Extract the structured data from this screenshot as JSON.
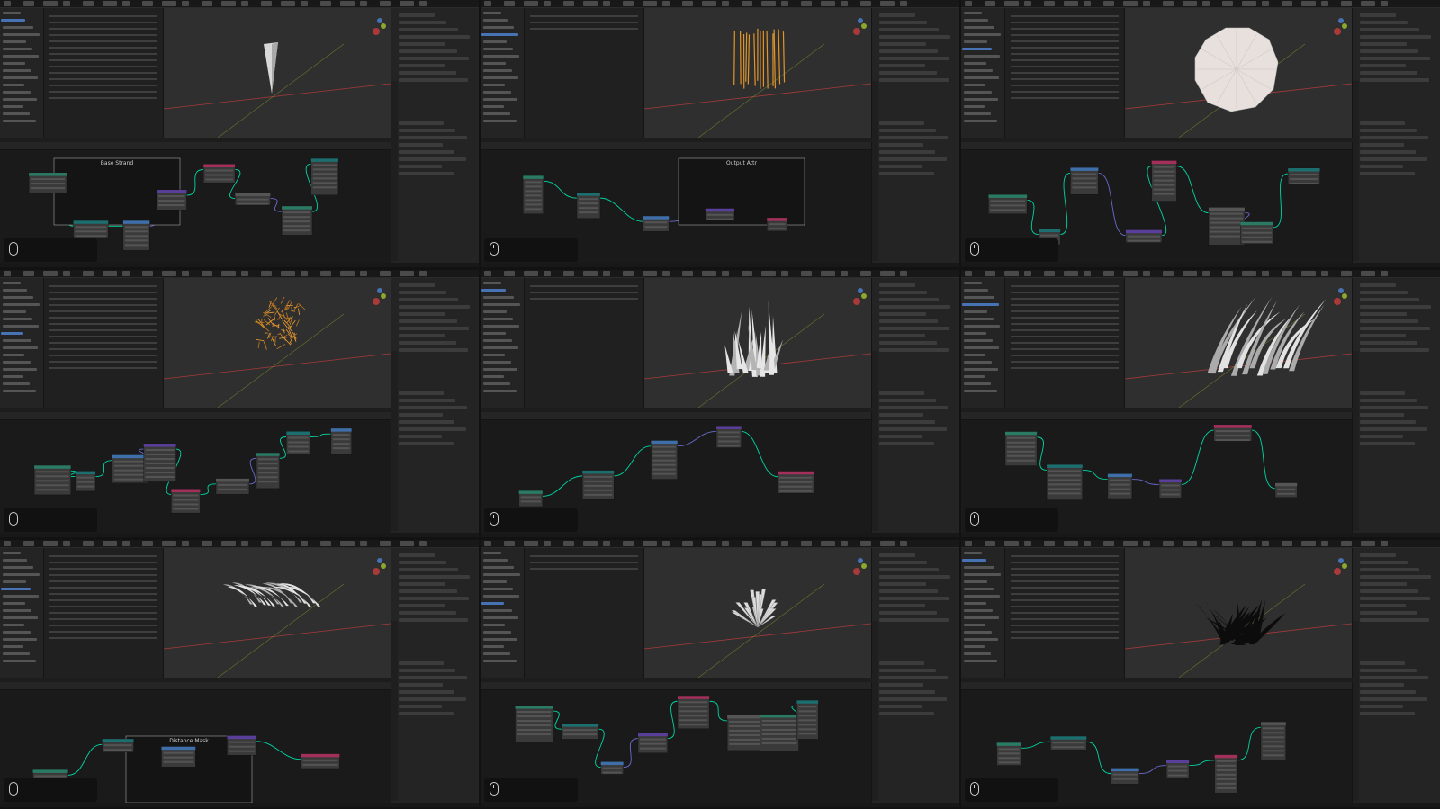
{
  "colors": {
    "accent": "#4772b3",
    "geometry_link": "#00d6a3",
    "node_header_green": "#2a7a64",
    "node_header_teal": "#1d6e6e",
    "node_header_blue": "#3f6fa8",
    "node_header_purple": "#5a3f9a",
    "node_header_pink": "#a3305a",
    "x_axis": "#a83a3a",
    "y_axis": "#8aa82b"
  },
  "icons": {
    "mouse": "mouse-icon",
    "gizmo": "axis-gizmo-icon"
  },
  "cells": [
    {
      "frame_title": "Base Strand",
      "object": "cone"
    },
    {
      "frame_title": "Output Attr",
      "object": "lines"
    },
    {
      "frame_title": "",
      "object": "disc"
    },
    {
      "frame_title": "",
      "object": "tangle"
    },
    {
      "frame_title": "",
      "object": "spikes"
    },
    {
      "frame_title": "",
      "object": "curved"
    },
    {
      "frame_title": "Distance Mask",
      "object": "swept"
    },
    {
      "frame_title": "",
      "object": "spread"
    },
    {
      "frame_title": "",
      "object": "grass"
    }
  ]
}
